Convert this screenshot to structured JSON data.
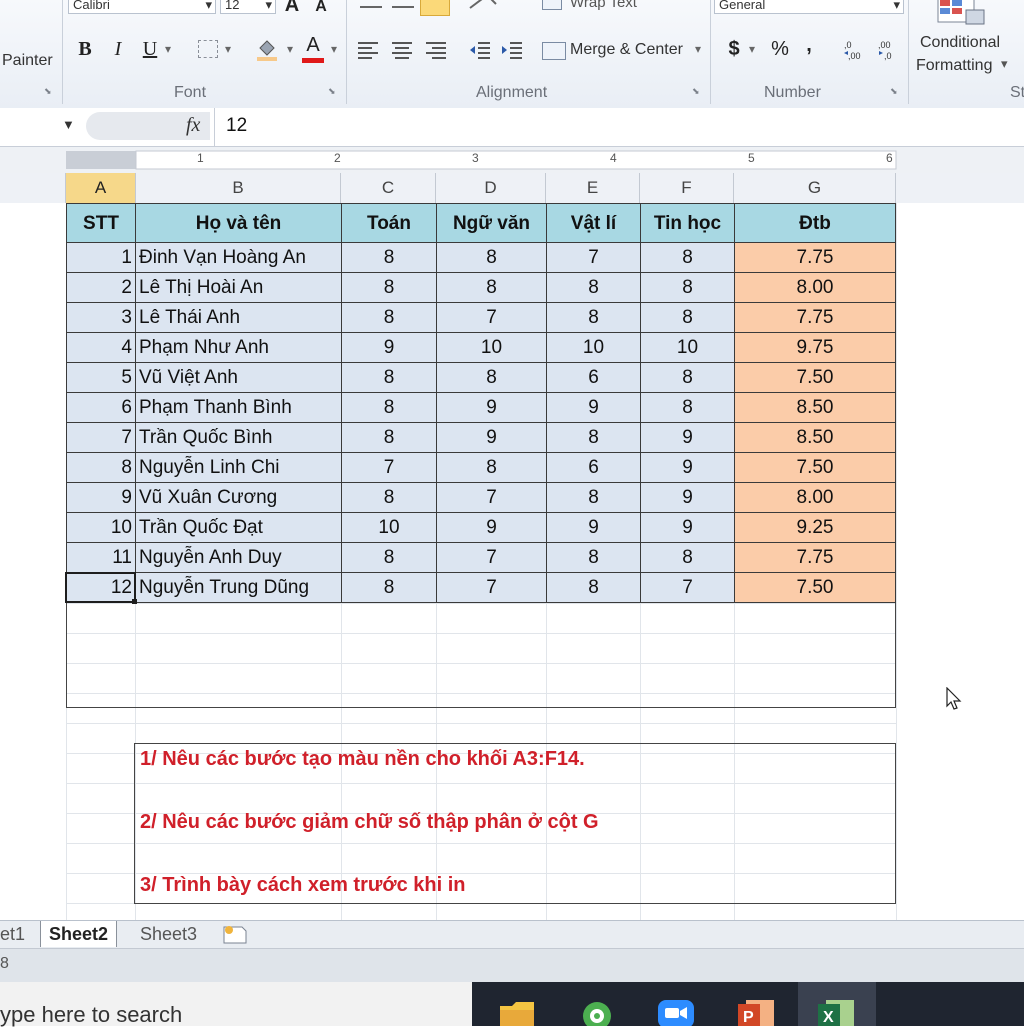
{
  "ribbon": {
    "clipboard": {
      "painter_label": "Painter"
    },
    "font": {
      "font_name": "Calibri",
      "font_size": "12",
      "grow_label": "A",
      "shrink_label": "A",
      "bold_label": "B",
      "italic_label": "I",
      "underline_label": "U",
      "font_color_label": "A",
      "group_label": "Font"
    },
    "alignment": {
      "wrap_text_label": "Wrap Text",
      "merge_center_label": "Merge & Center",
      "group_label": "Alignment"
    },
    "number": {
      "format_value": "General",
      "currency_label": "$",
      "percent_label": "%",
      "comma_label": ",",
      "group_label": "Number"
    },
    "styles": {
      "conditional_line1": "Conditional",
      "conditional_line2": "Formatting",
      "group_label_partial": "St"
    }
  },
  "formula_bar": {
    "fx_label": "fx",
    "value": "12"
  },
  "ruler": {
    "marks": [
      "1",
      "2",
      "3",
      "4",
      "5",
      "6"
    ]
  },
  "columns": [
    "A",
    "B",
    "C",
    "D",
    "E",
    "F",
    "G"
  ],
  "table": {
    "headers": [
      "STT",
      "Họ và tên",
      "Toán",
      "Ngữ văn",
      "Vật lí",
      "Tin học",
      "Đtb"
    ],
    "rows": [
      [
        "1",
        "Đinh Vạn Hoàng An",
        "8",
        "8",
        "7",
        "8",
        "7.75"
      ],
      [
        "2",
        "Lê Thị Hoài An",
        "8",
        "8",
        "8",
        "8",
        "8.00"
      ],
      [
        "3",
        "Lê Thái Anh",
        "8",
        "7",
        "8",
        "8",
        "7.75"
      ],
      [
        "4",
        "Phạm Như Anh",
        "9",
        "10",
        "10",
        "10",
        "9.75"
      ],
      [
        "5",
        "Vũ Việt Anh",
        "8",
        "8",
        "6",
        "8",
        "7.50"
      ],
      [
        "6",
        "Phạm Thanh Bình",
        "8",
        "9",
        "9",
        "8",
        "8.50"
      ],
      [
        "7",
        "Trần Quốc Bình",
        "8",
        "9",
        "8",
        "9",
        "8.50"
      ],
      [
        "8",
        "Nguyễn Linh Chi",
        "7",
        "8",
        "6",
        "9",
        "7.50"
      ],
      [
        "9",
        "Vũ Xuân Cương",
        "8",
        "7",
        "8",
        "9",
        "8.00"
      ],
      [
        "10",
        "Trần Quốc Đạt",
        "10",
        "9",
        "9",
        "9",
        "9.25"
      ],
      [
        "11",
        "Nguyễn Anh Duy",
        "8",
        "7",
        "8",
        "8",
        "7.75"
      ],
      [
        "12",
        "Nguyễn Trung Dũng",
        "8",
        "7",
        "8",
        "7",
        "7.50"
      ]
    ]
  },
  "questions": [
    "1/ Nêu các bước tạo màu nền cho khối  A3:F14.",
    "2/  Nêu các bước  giảm chữ số thập phân ở cột G",
    "3/  Trình bày cách xem trước khi in"
  ],
  "sheet_tabs": [
    "et1",
    "Sheet2",
    "Sheet3"
  ],
  "status": {
    "left_text": "8"
  },
  "taskbar": {
    "search_placeholder": "ype here to search"
  },
  "colors": {
    "header_fill": "#a8d8e3",
    "blue_fill": "#dce5f1",
    "orange_fill": "#fbcca9",
    "question_red": "#d0202a"
  }
}
